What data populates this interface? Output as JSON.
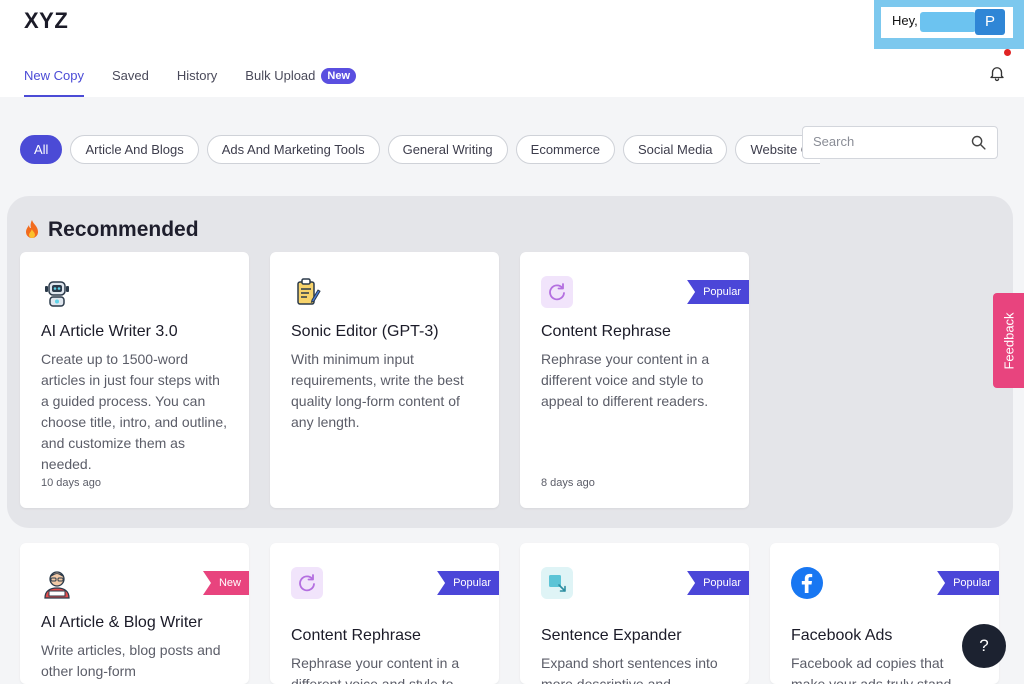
{
  "app": {
    "logo": "XYZ"
  },
  "tabs": [
    {
      "label": "New Copy",
      "active": true
    },
    {
      "label": "Saved"
    },
    {
      "label": "History"
    },
    {
      "label": "Bulk Upload",
      "badge": "New"
    }
  ],
  "user": {
    "greeting": "Hey,",
    "avatar_initial": "P"
  },
  "filters": [
    "All",
    "Article And Blogs",
    "Ads And Marketing Tools",
    "General Writing",
    "Ecommerce",
    "Social Media",
    "Website C",
    "",
    ""
  ],
  "search": {
    "placeholder": "Search"
  },
  "recommended": {
    "title": "Recommended",
    "cards": [
      {
        "icon": "robot-icon",
        "title": "AI Article Writer 3.0",
        "description": "Create up to 1500-word articles in just four steps with a guided process. You can choose title, intro, and outline, and customize them as needed.",
        "meta": "10 days ago",
        "ribbon": ""
      },
      {
        "icon": "clipboard-pen-icon",
        "title": "Sonic Editor (GPT-3)",
        "description": "With minimum input requirements, write the best quality long-form content of any length.",
        "meta": "",
        "ribbon": ""
      },
      {
        "icon": "refresh-icon",
        "title": "Content Rephrase",
        "description": "Rephrase your content in a different voice and style to appeal to different readers.",
        "meta": "8 days ago",
        "ribbon": "Popular"
      }
    ]
  },
  "tools": [
    {
      "icon": "writer-avatar-icon",
      "title": "AI Article & Blog Writer",
      "description": "Write articles, blog posts and other long-form",
      "ribbon": "New"
    },
    {
      "icon": "refresh-icon",
      "title": "Content Rephrase",
      "description": "Rephrase your content in a different voice and style to",
      "ribbon": "Popular"
    },
    {
      "icon": "expand-icon",
      "title": "Sentence Expander",
      "description": "Expand short sentences into more descriptive and",
      "ribbon": "Popular"
    },
    {
      "icon": "facebook-icon",
      "title": "Facebook Ads",
      "description": "Facebook ad copies that make your ads truly stand",
      "ribbon": "Popular"
    }
  ],
  "feedback_label": "Feedback",
  "help_label": "?"
}
